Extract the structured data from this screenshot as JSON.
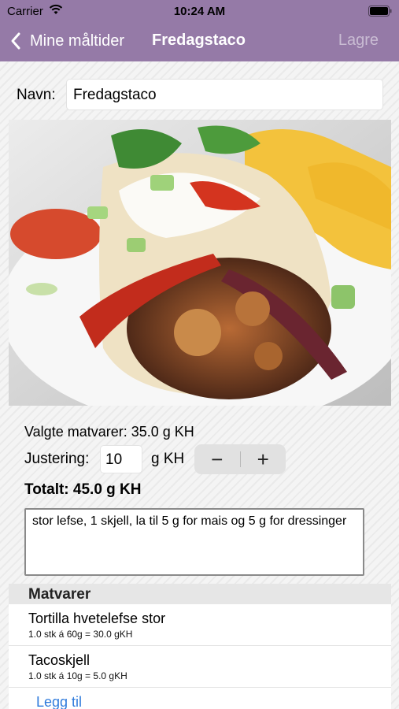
{
  "status_bar": {
    "carrier": "Carrier",
    "time": "10:24 AM"
  },
  "nav": {
    "back_label": "Mine måltider",
    "title": "Fredagstaco",
    "save_label": "Lagre"
  },
  "form": {
    "name_label": "Navn:",
    "name_value": "Fredagstaco",
    "selected_foods": "Valgte matvarer: 35.0 g KH",
    "adjustment_label": "Justering:",
    "adjustment_value": "10",
    "adjustment_unit": "g KH",
    "total": "Totalt: 45.0 g KH",
    "notes": "stor lefse, 1 skjell, la til 5 g for mais og 5 g for dressinger",
    "stepper": {
      "minus": "−",
      "plus": "+"
    }
  },
  "foods": {
    "header": "Matvarer",
    "items": [
      {
        "name": "Tortilla hvetelefse stor",
        "detail": "1.0 stk á 60g = 30.0 gKH"
      },
      {
        "name": "Tacoskjell",
        "detail": "1.0 stk á 10g = 5.0 gKH"
      }
    ],
    "add_label": "Legg til"
  },
  "colors": {
    "nav_bar": "#957aa7",
    "link": "#2f7bdc"
  },
  "icons": [
    "wifi-icon",
    "battery-icon",
    "chevron-left-icon"
  ]
}
